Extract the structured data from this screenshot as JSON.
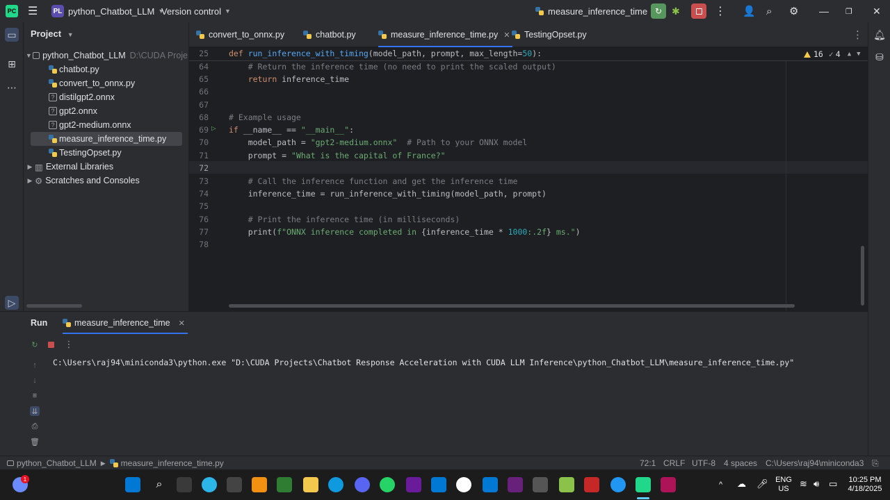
{
  "titlebar": {
    "project_badge": "PL",
    "project_name": "python_Chatbot_LLM",
    "vcs_label": "Version control",
    "run_config": "measure_inference_time"
  },
  "project_panel": {
    "title": "Project",
    "root": {
      "name": "python_Chatbot_LLM",
      "path": "D:\\CUDA Proje"
    },
    "files": [
      {
        "name": "chatbot.py",
        "type": "python"
      },
      {
        "name": "convert_to_onnx.py",
        "type": "python"
      },
      {
        "name": "distilgpt2.onnx",
        "type": "unknown"
      },
      {
        "name": "gpt2.onnx",
        "type": "unknown"
      },
      {
        "name": "gpt2-medium.onnx",
        "type": "unknown"
      },
      {
        "name": "measure_inference_time.py",
        "type": "python",
        "selected": true
      },
      {
        "name": "TestingOpset.py",
        "type": "python"
      }
    ],
    "external_libraries": "External Libraries",
    "scratches": "Scratches and Consoles"
  },
  "editor_tabs": [
    {
      "label": "convert_to_onnx.py"
    },
    {
      "label": "chatbot.py"
    },
    {
      "label": "measure_inference_time.py",
      "active": true
    },
    {
      "label": "TestingOpset.py"
    }
  ],
  "editor": {
    "sticky_line_no": "25",
    "sticky_code": "def run_inference_with_timing(model_path, prompt, max_length=50):",
    "warnings_count": "16",
    "weak_warnings_count": "4",
    "lines": [
      {
        "no": "64",
        "text": "    # Return the inference time (no need to print the scaled output)"
      },
      {
        "no": "65",
        "text": "    return inference_time"
      },
      {
        "no": "66",
        "text": ""
      },
      {
        "no": "67",
        "text": ""
      },
      {
        "no": "68",
        "text": "# Example usage"
      },
      {
        "no": "69",
        "text": "if __name__ == \"__main__\":"
      },
      {
        "no": "70",
        "text": "    model_path = \"gpt2-medium.onnx\"  # Path to your ONNX model"
      },
      {
        "no": "71",
        "text": "    prompt = \"What is the capital of France?\""
      },
      {
        "no": "72",
        "text": ""
      },
      {
        "no": "73",
        "text": "    # Call the inference function and get the inference time"
      },
      {
        "no": "74",
        "text": "    inference_time = run_inference_with_timing(model_path, prompt)"
      },
      {
        "no": "75",
        "text": ""
      },
      {
        "no": "76",
        "text": "    # Print the inference time (in milliseconds)"
      },
      {
        "no": "77",
        "text": "    print(f\"ONNX inference completed in {inference_time * 1000:.2f} ms.\")"
      },
      {
        "no": "78",
        "text": ""
      }
    ]
  },
  "run_panel": {
    "title": "Run",
    "tab_label": "measure_inference_time",
    "console_output": "C:\\Users\\raj94\\miniconda3\\python.exe \"D:\\CUDA Projects\\Chatbot Response Acceleration with CUDA LLM Inference\\python_Chatbot_LLM\\measure_inference_time.py\""
  },
  "statusbar": {
    "breadcrumb_project": "python_Chatbot_LLM",
    "breadcrumb_file": "measure_inference_time.py",
    "caret": "72:1",
    "line_sep": "CRLF",
    "encoding": "UTF-8",
    "indent": "4 spaces",
    "interpreter": "C:\\Users\\raj94\\miniconda3"
  },
  "taskbar": {
    "lang": "ENG",
    "region": "US",
    "time": "10:25 PM",
    "date": "4/18/2025",
    "notif_count": "1"
  },
  "colors": {
    "accent": "#3574f0",
    "run_green": "#57965c",
    "stop_red": "#c94f4f"
  }
}
